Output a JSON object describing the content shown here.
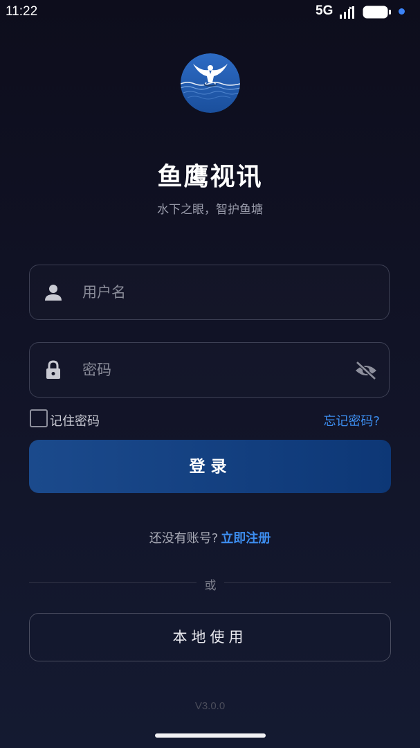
{
  "status_bar": {
    "time": "11:22",
    "network": "5G",
    "signal_icon": "signal-bars-icon",
    "battery_icon": "battery-icon",
    "indicator_color": "#3b82f6"
  },
  "header": {
    "logo": "fish-eagle-logo",
    "title": "鱼鹰视讯",
    "subtitle": "水下之眼，智护鱼塘"
  },
  "form": {
    "username": {
      "icon": "user-icon",
      "placeholder": "用户名",
      "value": ""
    },
    "password": {
      "icon": "lock-icon",
      "placeholder": "密码",
      "value": "",
      "visibility_icon": "eye-off-icon"
    },
    "remember": {
      "label": "记住密码",
      "checked": false
    },
    "forgot_label": "忘记密码?",
    "login_label": "登录"
  },
  "register": {
    "prompt": "还没有账号?",
    "link_label": "立即注册"
  },
  "divider_text": "或",
  "local_use_label": "本地使用",
  "version": "V3.0.0",
  "colors": {
    "accent": "#3d8ef0",
    "primary_button": "#0d3776",
    "background": "#111326"
  }
}
